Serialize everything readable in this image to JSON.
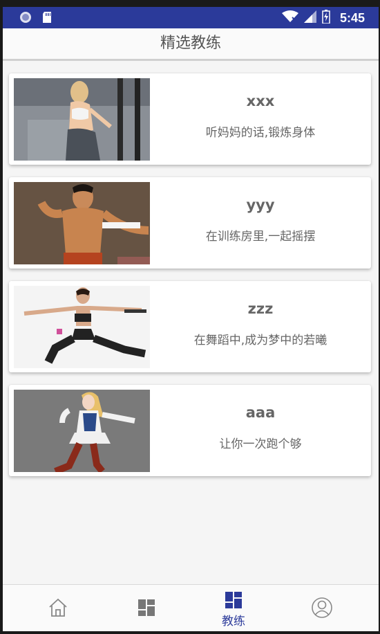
{
  "status_bar": {
    "time": "5:45",
    "icons": [
      "circle-icon",
      "sd-card-icon",
      "wifi-icon",
      "signal-icon",
      "battery-charging-icon"
    ]
  },
  "title": "精选教练",
  "coaches": [
    {
      "name": "xxx",
      "desc": "听妈妈的话,锻炼身体",
      "photo": "woman-gym-photo"
    },
    {
      "name": "yyy",
      "desc": "在训练房里,一起摇摆",
      "photo": "man-muscle-photo"
    },
    {
      "name": "zzz",
      "desc": "在舞蹈中,成为梦中的若曦",
      "photo": "woman-yoga-photo"
    },
    {
      "name": "aaa",
      "desc": "让你一次跑个够",
      "photo": "anime-girl-photo"
    }
  ],
  "bottom_nav": {
    "items": [
      {
        "id": "home",
        "icon": "home-icon",
        "label": ""
      },
      {
        "id": "grid",
        "icon": "dashboard-icon",
        "label": ""
      },
      {
        "id": "coach",
        "icon": "dashboard-icon",
        "label": "教练",
        "active": true
      },
      {
        "id": "profile",
        "icon": "user-icon",
        "label": ""
      }
    ],
    "active_color": "#2b3a9a",
    "inactive_color": "#888888"
  },
  "colors": {
    "status_bar": "#2b3a9a",
    "background": "#f5f5f5"
  }
}
